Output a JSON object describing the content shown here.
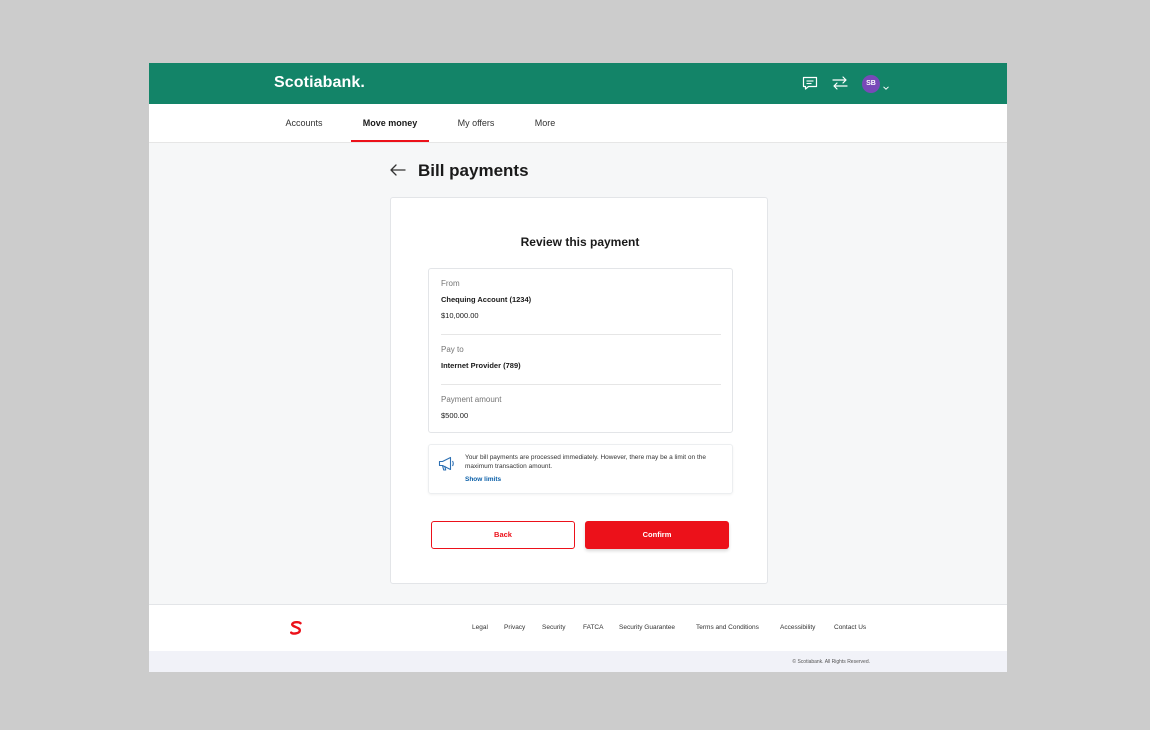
{
  "header": {
    "brand": "Scotiabank.",
    "avatar_initials": "SB",
    "icons": [
      "chat-icon",
      "transfer-icon",
      "chevron-down-icon"
    ],
    "color": "#138468"
  },
  "nav": {
    "items": [
      {
        "label": "Accounts"
      },
      {
        "label": "Move money"
      },
      {
        "label": "My offers"
      },
      {
        "label": "More"
      }
    ],
    "active": "Move money",
    "accent": "#ec111a"
  },
  "page": {
    "title": "Bill payments"
  },
  "review": {
    "title": "Review this payment",
    "from_label": "From",
    "from_account": "Chequing Account (1234)",
    "from_balance": "$10,000.00",
    "payto_label": "Pay to",
    "payto_value": "Internet Provider (789)",
    "amount_label": "Payment amount",
    "amount_value": "$500.00"
  },
  "notice": {
    "text": "Your bill payments are processed immediately. However, there may be a limit on the maximum transaction amount.",
    "link": "Show limits",
    "icon": "megaphone-icon"
  },
  "actions": {
    "back": "Back",
    "confirm": "Confirm"
  },
  "footer": {
    "links": [
      "Legal",
      "Privacy",
      "Security",
      "FATCA",
      "Security Guarantee",
      "Terms and Conditions",
      "Accessibility",
      "Contact Us"
    ],
    "copyright": "© Scotiabank. All Rights Reserved."
  }
}
